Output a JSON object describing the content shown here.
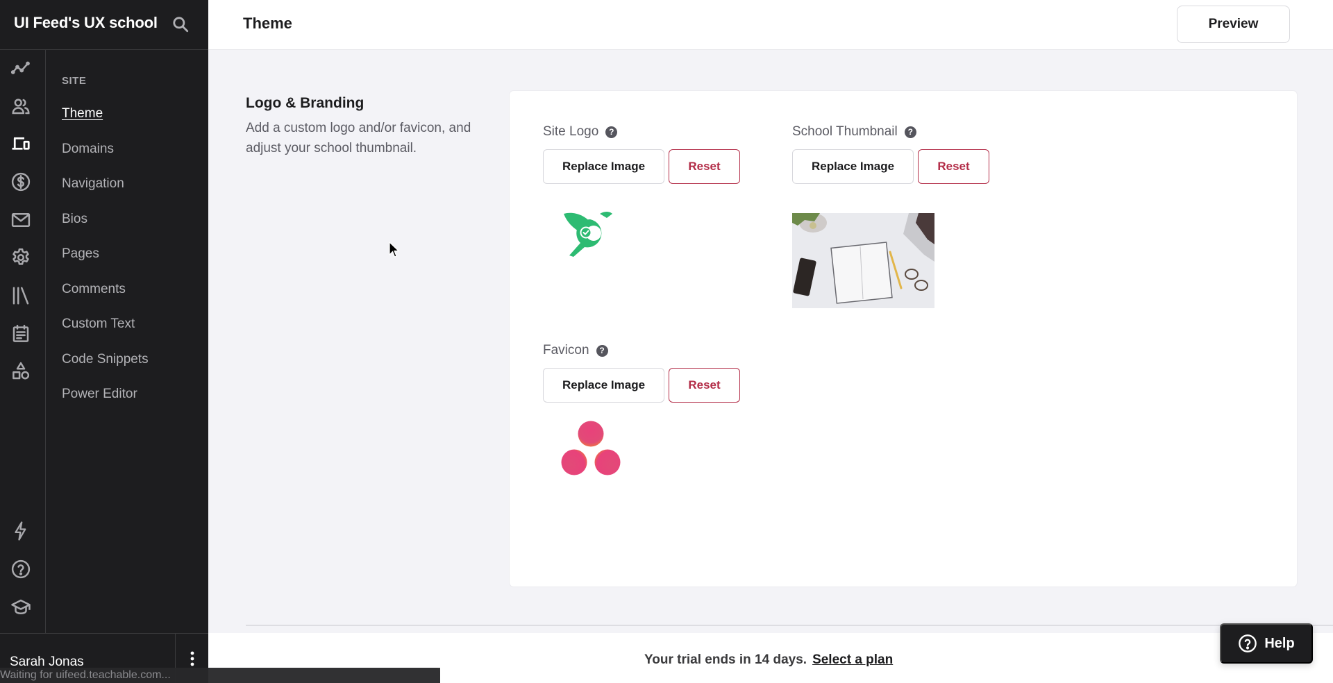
{
  "sidebar": {
    "title": "UI Feed's UX school",
    "rail_icons": [
      "analytics-icon",
      "users-icon",
      "site-devices-icon",
      "sales-dollar-icon",
      "emails-icon",
      "settings-gear-icon",
      "library-icon",
      "calendar-icon",
      "shapes-icon"
    ],
    "rail_bottom_icons": [
      "lightning-icon",
      "help-circle-icon",
      "graduation-cap-icon"
    ],
    "section_heading": "SITE",
    "items": [
      {
        "label": "Theme",
        "active": true
      },
      {
        "label": "Domains",
        "active": false
      },
      {
        "label": "Navigation",
        "active": false
      },
      {
        "label": "Bios",
        "active": false
      },
      {
        "label": "Pages",
        "active": false
      },
      {
        "label": "Comments",
        "active": false
      },
      {
        "label": "Custom Text",
        "active": false
      },
      {
        "label": "Code Snippets",
        "active": false
      },
      {
        "label": "Power Editor",
        "active": false
      }
    ],
    "user_name": "Sarah Jonas"
  },
  "status_bar": {
    "text": "Waiting for uifeed.teachable.com..."
  },
  "header": {
    "title": "Theme",
    "preview_label": "Preview"
  },
  "section": {
    "title": "Logo & Branding",
    "description": "Add a custom logo and/or favicon, and adjust your school thumbnail."
  },
  "fields": {
    "site_logo": {
      "label": "Site Logo",
      "replace_label": "Replace Image",
      "reset_label": "Reset"
    },
    "school_thumbnail": {
      "label": "School Thumbnail",
      "replace_label": "Replace Image",
      "reset_label": "Reset"
    },
    "favicon": {
      "label": "Favicon",
      "replace_label": "Replace Image",
      "reset_label": "Reset"
    }
  },
  "trial": {
    "message": "Your trial ends in 14 days.",
    "link_label": "Select a plan"
  },
  "help_button": {
    "label": "Help"
  },
  "colors": {
    "sidebar_bg": "#1d1d1f",
    "accent_reset": "#b32d48",
    "logo_green": "#2dbb72",
    "favicon_pink": "#e8427a",
    "favicon_orange": "#f07a3a"
  }
}
